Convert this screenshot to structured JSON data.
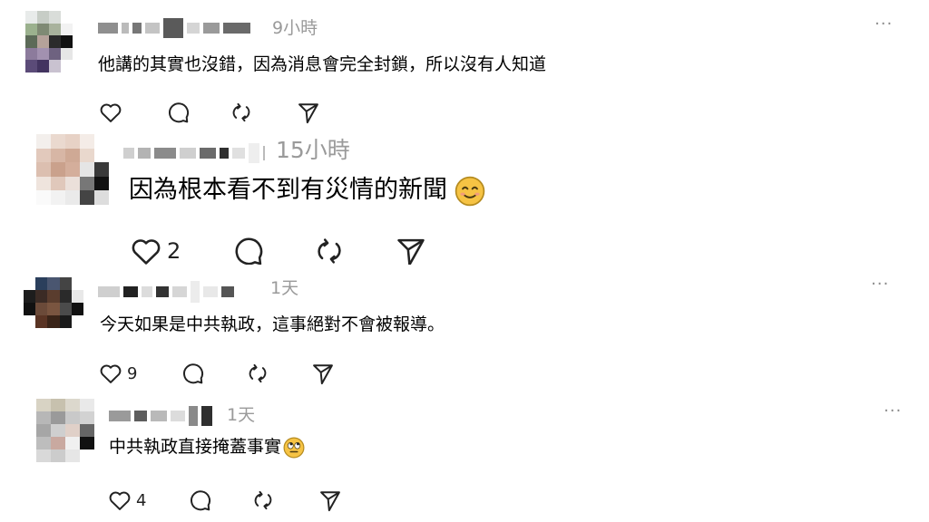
{
  "comments": [
    {
      "time": "9小時",
      "text": "他講的其實也沒錯，因為消息會完全封鎖，所以沒有人知道",
      "more": "···",
      "like_count": "",
      "emoji": ""
    },
    {
      "time": "15小時",
      "text": "因為根本看不到有災情的新聞",
      "more": "",
      "like_count": "2",
      "emoji": "smiling-face-icon"
    },
    {
      "time": "1天",
      "text": "今天如果是中共執政，這事絕對不會被報導。",
      "more": "···",
      "like_count": "9",
      "emoji": ""
    },
    {
      "time": "1天",
      "text": "中共執政直接掩蓋事實",
      "more": "···",
      "like_count": "4",
      "emoji": "rolling-eyes-face-icon"
    }
  ],
  "colors": {
    "time": "#9a9a9a",
    "icon": "#222222",
    "emoji_yellow": "#f6c344"
  }
}
